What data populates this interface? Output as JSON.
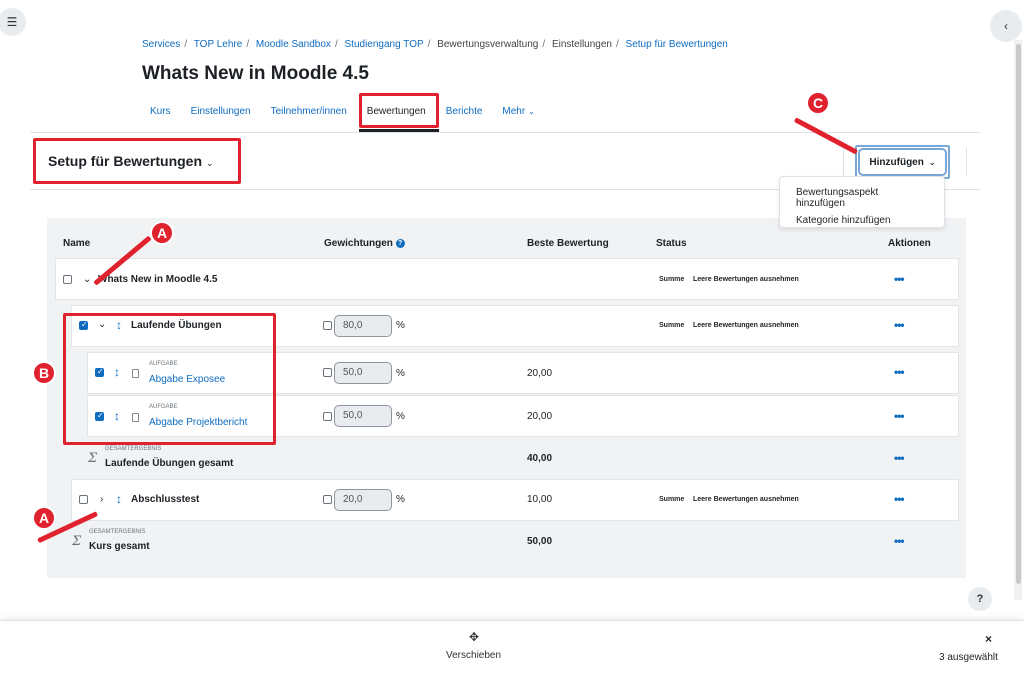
{
  "breadcrumb": {
    "items": [
      "Services",
      "TOP Lehre",
      "Moodle Sandbox",
      "Studiengang TOP"
    ],
    "plain": [
      "Bewertungsverwaltung",
      "Einstellungen"
    ],
    "last": "Setup für Bewertungen"
  },
  "page_title": "Whats New in Moodle 4.5",
  "nav": {
    "tabs": [
      "Kurs",
      "Einstellungen",
      "Teilnehmer/innen",
      "Bewertungen",
      "Berichte",
      "Mehr"
    ],
    "active": "Bewertungen"
  },
  "setup": {
    "title": "Setup für Bewertungen"
  },
  "add_button": {
    "label": "Hinzufügen",
    "menu": [
      "Bewertungsaspekt hinzufügen",
      "Kategorie hinzufügen"
    ]
  },
  "table": {
    "headers": {
      "name": "Name",
      "weights": "Gewichtungen",
      "max": "Beste Bewertung",
      "status": "Status",
      "actions": "Aktionen"
    },
    "course_row": {
      "name": "Whats New in Moodle 4.5",
      "status1": "Summe",
      "status2": "Leere Bewertungen ausnehmen"
    },
    "category1": {
      "name": "Laufende Übungen",
      "weight": "80,0",
      "status1": "Summe",
      "status2": "Leere Bewertungen ausnehmen"
    },
    "item1": {
      "type": "AUFGABE",
      "name": "Abgabe Exposee",
      "weight": "50,0",
      "max": "20,00"
    },
    "item2": {
      "type": "AUFGABE",
      "name": "Abgabe Projektbericht",
      "weight": "50,0",
      "max": "20,00"
    },
    "total1": {
      "type": "GESAMTERGEBNIS",
      "name": "Laufende Übungen gesamt",
      "max": "40,00"
    },
    "category2": {
      "name": "Abschlusstest",
      "weight": "20,0",
      "max": "10,00",
      "status1": "Summe",
      "status2": "Leere Bewertungen ausnehmen"
    },
    "total2": {
      "type": "GESAMTERGEBNIS",
      "name": "Kurs gesamt",
      "max": "50,00"
    },
    "percent": "%",
    "dots": "•••"
  },
  "footer": {
    "move_label": "Verschieben",
    "selected": "3 ausgewählt",
    "close": "×"
  },
  "markers": {
    "a": "A",
    "b": "B",
    "c": "C"
  },
  "help": "?",
  "colors": {
    "accent": "#0f6cbf",
    "annotation": "#e0222f"
  }
}
